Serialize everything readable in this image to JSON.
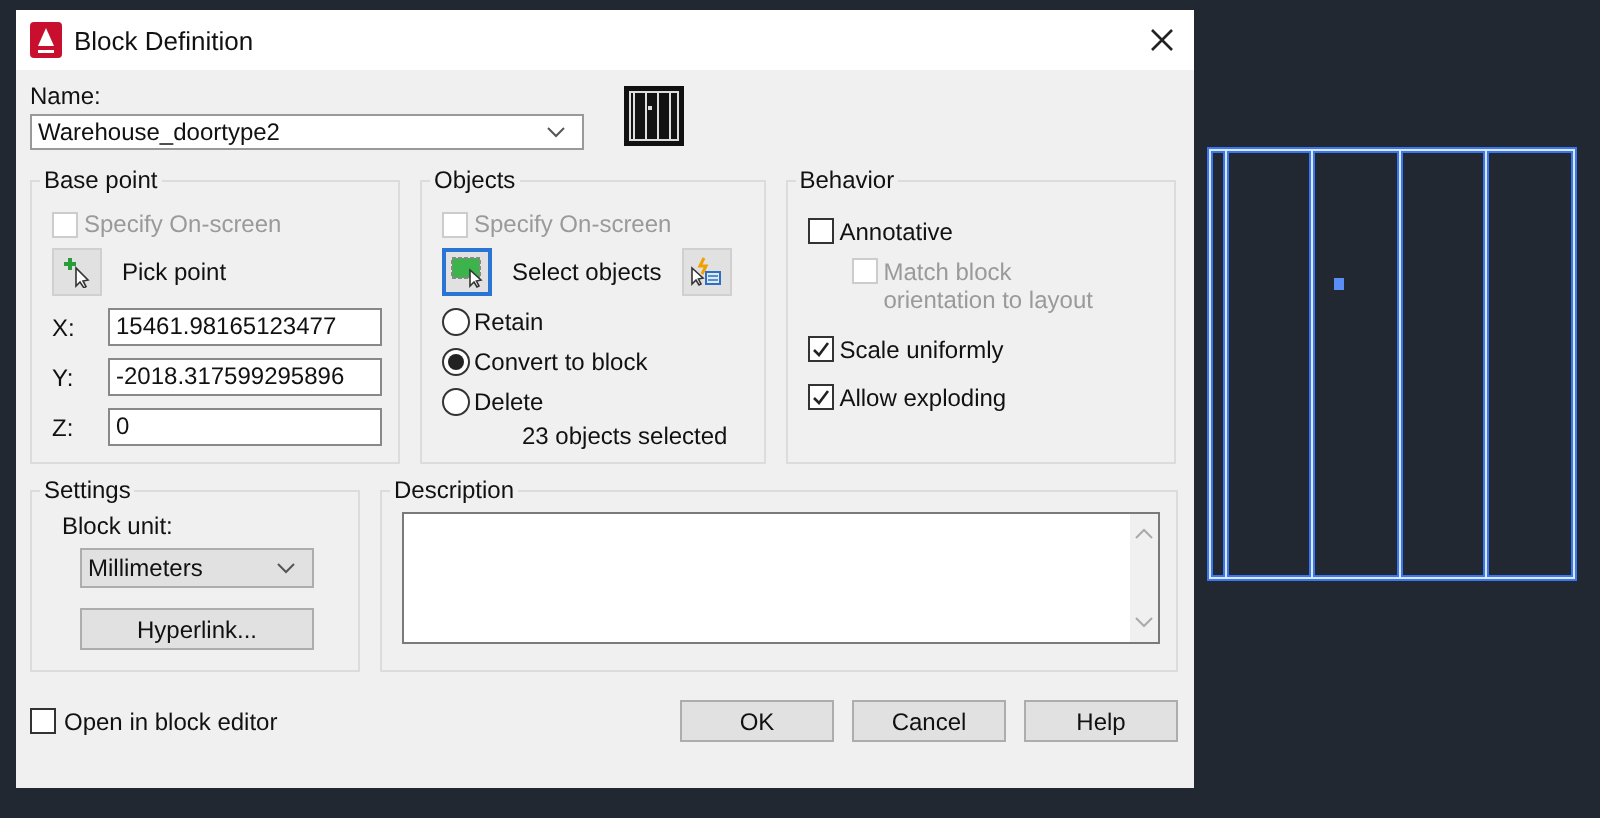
{
  "window": {
    "title": "Block Definition"
  },
  "name": {
    "label": "Name:",
    "value": "Warehouse_doortype2"
  },
  "base_point": {
    "title": "Base point",
    "specify_on_screen": {
      "label": "Specify On-screen",
      "checked": false,
      "disabled": true
    },
    "pick_button": "Pick point",
    "coords": [
      {
        "label": "X:",
        "value": "15461.98165123477"
      },
      {
        "label": "Y:",
        "value": "-2018.317599295896"
      },
      {
        "label": "Z:",
        "value": "0"
      }
    ]
  },
  "objects": {
    "title": "Objects",
    "specify_on_screen": {
      "label": "Specify On-screen",
      "checked": false,
      "disabled": true
    },
    "select_button": "Select objects",
    "options": [
      {
        "label": "Retain",
        "selected": false
      },
      {
        "label": "Convert to block",
        "selected": true
      },
      {
        "label": "Delete",
        "selected": false
      }
    ],
    "count": "23 objects selected"
  },
  "behavior": {
    "title": "Behavior",
    "options": [
      {
        "label": "Annotative",
        "checked": false,
        "disabled": false,
        "children": [
          {
            "label": "Match block orientation to layout",
            "checked": false,
            "disabled": true
          }
        ]
      },
      {
        "label": "Scale uniformly",
        "checked": true,
        "disabled": false
      },
      {
        "label": "Allow exploding",
        "checked": true,
        "disabled": false
      }
    ]
  },
  "settings": {
    "title": "Settings",
    "unit_label": "Block unit:",
    "unit_value": "Millimeters",
    "hyperlink_button": "Hyperlink..."
  },
  "description": {
    "title": "Description"
  },
  "open_in_block_editor": {
    "label": "Open in block editor",
    "checked": false
  },
  "buttons": [
    "OK",
    "Cancel",
    "Help"
  ]
}
